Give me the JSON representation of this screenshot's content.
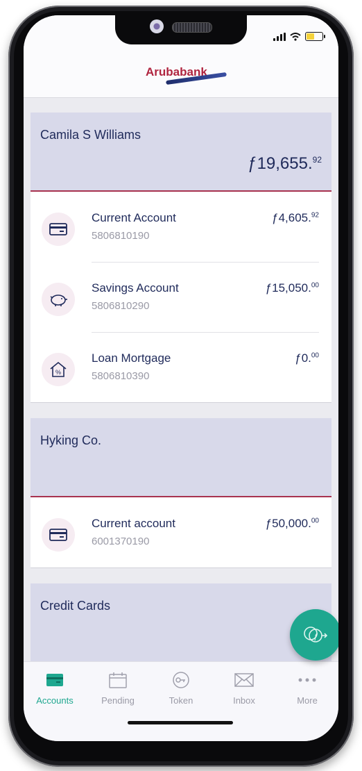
{
  "app": {
    "brand": "Arubabank"
  },
  "groups": [
    {
      "name": "Camila S Williams",
      "total_main": "ƒ19,655.",
      "total_cents": "92",
      "accounts": [
        {
          "title": "Current Account",
          "number": "5806810190",
          "amount_main": "ƒ4,605.",
          "amount_cents": "92",
          "icon": "card-icon"
        },
        {
          "title": "Savings Account",
          "number": "5806810290",
          "amount_main": "ƒ15,050.",
          "amount_cents": "00",
          "icon": "piggy-bank-icon"
        },
        {
          "title": "Loan Mortgage",
          "number": "5806810390",
          "amount_main": "ƒ0.",
          "amount_cents": "00",
          "icon": "house-percent-icon"
        }
      ]
    },
    {
      "name": "Hyking Co.",
      "accounts": [
        {
          "title": "Current account",
          "number": "6001370190",
          "amount_main": "ƒ50,000.",
          "amount_cents": "00",
          "icon": "card-icon"
        }
      ]
    },
    {
      "name": "Credit Cards",
      "accounts": []
    }
  ],
  "tabs": [
    {
      "label": "Accounts",
      "icon": "card-icon",
      "active": true
    },
    {
      "label": "Pending",
      "icon": "calendar-icon",
      "active": false
    },
    {
      "label": "Token",
      "icon": "token-icon",
      "active": false
    },
    {
      "label": "Inbox",
      "icon": "envelope-icon",
      "active": false
    },
    {
      "label": "More",
      "icon": "more-dots-icon",
      "active": false
    }
  ],
  "colors": {
    "accent": "#1ea78f",
    "brand_red": "#b0243f",
    "navy": "#1f2a5a",
    "group_bg": "#d8d9ea"
  }
}
